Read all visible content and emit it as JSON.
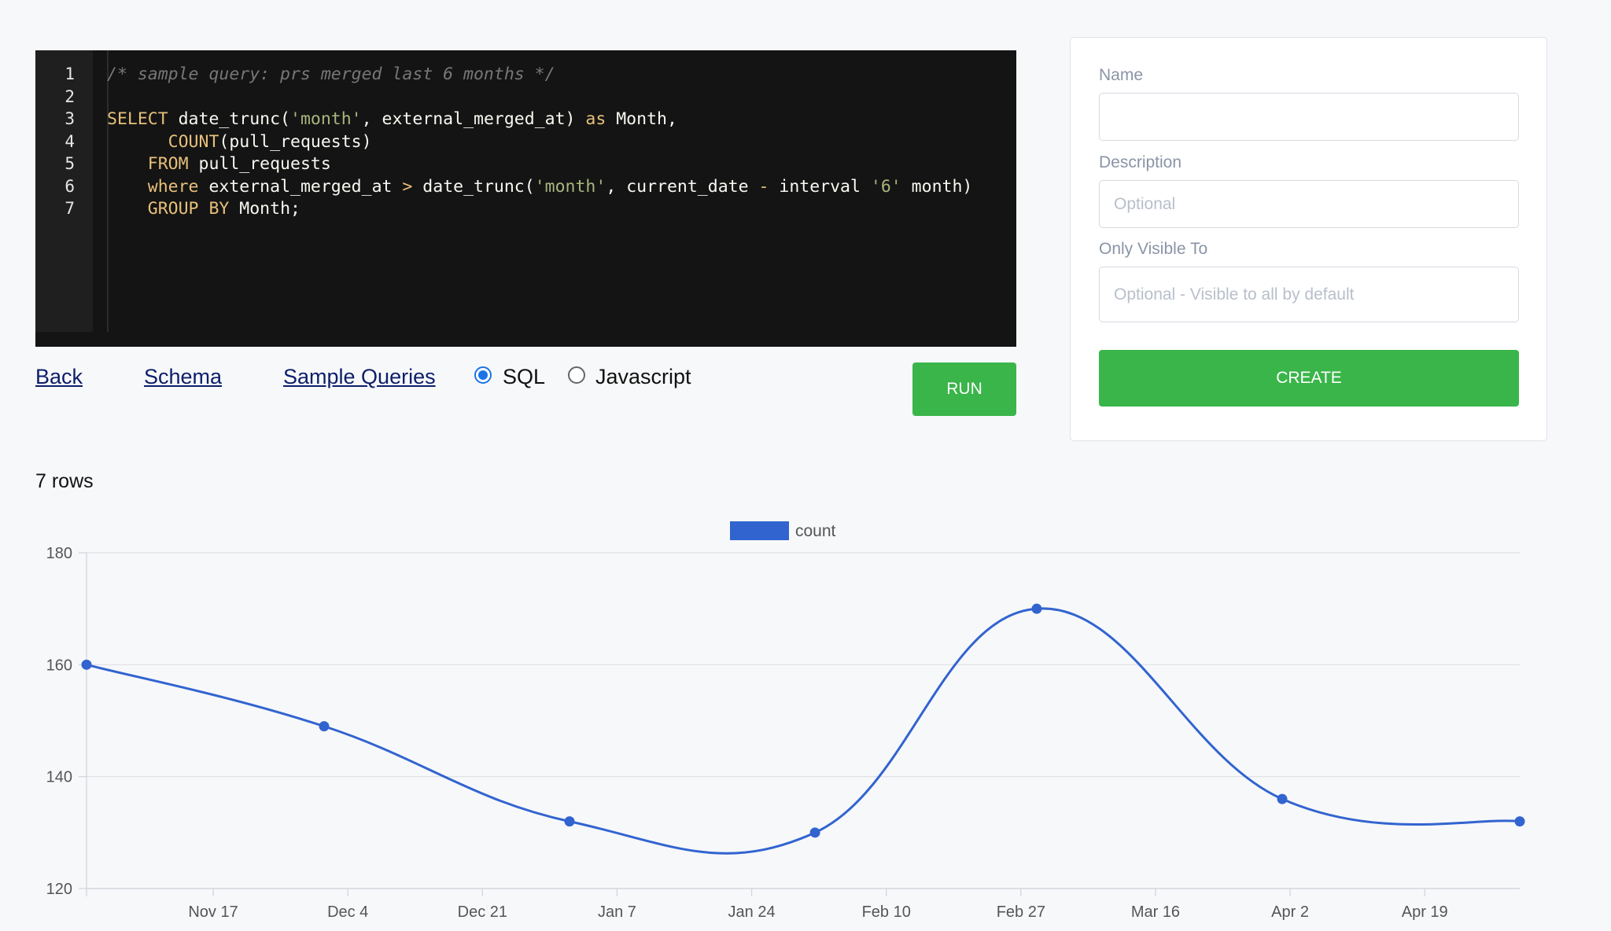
{
  "editor": {
    "line_numbers": [
      "1",
      "2",
      "3",
      "4",
      "5",
      "6",
      "7"
    ],
    "lines": [
      [
        {
          "t": "/* sample query: prs merged last 6 months */",
          "c": "cm"
        }
      ],
      [],
      [
        {
          "t": "SELECT",
          "c": "kw"
        },
        {
          "t": " date_trunc(",
          "c": ""
        },
        {
          "t": "'month'",
          "c": "str"
        },
        {
          "t": ", external_merged_at) ",
          "c": ""
        },
        {
          "t": "as",
          "c": "kw"
        },
        {
          "t": " Month,",
          "c": ""
        }
      ],
      [
        {
          "t": "      ",
          "c": ""
        },
        {
          "t": "COUNT",
          "c": "kw"
        },
        {
          "t": "(pull_requests)",
          "c": ""
        }
      ],
      [
        {
          "t": "    ",
          "c": ""
        },
        {
          "t": "FROM",
          "c": "kw"
        },
        {
          "t": " pull_requests",
          "c": ""
        }
      ],
      [
        {
          "t": "    ",
          "c": ""
        },
        {
          "t": "where",
          "c": "kw"
        },
        {
          "t": " external_merged_at ",
          "c": ""
        },
        {
          "t": ">",
          "c": "op"
        },
        {
          "t": " date_trunc(",
          "c": ""
        },
        {
          "t": "'month'",
          "c": "str"
        },
        {
          "t": ", current_date ",
          "c": ""
        },
        {
          "t": "-",
          "c": "op"
        },
        {
          "t": " interval ",
          "c": ""
        },
        {
          "t": "'6'",
          "c": "str"
        },
        {
          "t": " month)",
          "c": ""
        }
      ],
      [
        {
          "t": "    ",
          "c": ""
        },
        {
          "t": "GROUP BY",
          "c": "kw"
        },
        {
          "t": " Month;",
          "c": ""
        }
      ]
    ]
  },
  "toolbar": {
    "back": "Back",
    "schema": "Schema",
    "sample_queries": "Sample Queries",
    "sql_label": "SQL",
    "js_label": "Javascript",
    "run": "RUN"
  },
  "form": {
    "name_label": "Name",
    "name_value": "",
    "description_label": "Description",
    "description_placeholder": "Optional",
    "visible_label": "Only Visible To",
    "visible_placeholder": "Optional - Visible to all by default",
    "create": "CREATE"
  },
  "result": {
    "rows_text": "7 rows"
  },
  "colors": {
    "accent_green": "#3ab54a",
    "series_blue": "#3264d0"
  },
  "chart_data": {
    "type": "line",
    "series": [
      {
        "name": "count",
        "color": "#3264d0",
        "points": [
          {
            "x": "2022-11-01",
            "y": 160
          },
          {
            "x": "2022-12-01",
            "y": 149
          },
          {
            "x": "2023-01-01",
            "y": 132
          },
          {
            "x": "2023-02-01",
            "y": 130
          },
          {
            "x": "2023-03-01",
            "y": 170
          },
          {
            "x": "2023-04-01",
            "y": 136
          },
          {
            "x": "2023-05-01",
            "y": 132
          }
        ]
      }
    ],
    "x_ticks": [
      "Nov 17",
      "Dec 4",
      "Dec 21",
      "Jan 7",
      "Jan 24",
      "Feb 10",
      "Feb 27",
      "Mar 16",
      "Apr 2",
      "Apr 19"
    ],
    "y_ticks": [
      120,
      140,
      160,
      180
    ],
    "ylim": [
      120,
      180
    ],
    "legend": "top-center",
    "grid": true
  }
}
